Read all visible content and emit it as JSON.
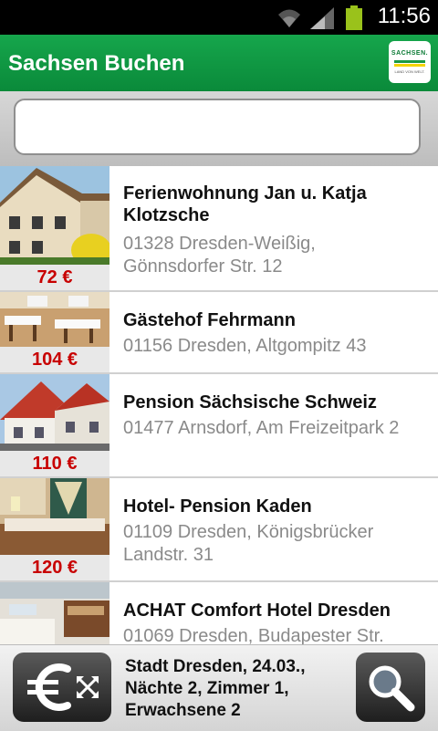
{
  "status_bar": {
    "time": "11:56",
    "icons": [
      "wifi-icon",
      "signal-icon",
      "battery-icon"
    ]
  },
  "header": {
    "title": "Sachsen Buchen",
    "logo_text": "SACHSEN.",
    "logo_subtext": "LAND VON WELT."
  },
  "search": {
    "value": "",
    "placeholder": ""
  },
  "hotels": [
    {
      "name": "Ferienwohnung Jan u. Katja Klotzsche",
      "address": "01328 Dresden-Weißig, Gönnsdorfer Str. 12",
      "price": "72 €"
    },
    {
      "name": "Gästehof Fehrmann",
      "address": "01156 Dresden, Altgompitz 43",
      "price": "104 €"
    },
    {
      "name": "Pension Sächsische Schweiz",
      "address": "01477 Arnsdorf, Am Freizeitpark 2",
      "price": "110 €"
    },
    {
      "name": "Hotel- Pension Kaden",
      "address": "01109 Dresden, Königsbrücker Landstr. 31",
      "price": "120 €"
    },
    {
      "name": "ACHAT Comfort Hotel Dresden",
      "address": "01069 Dresden, Budapester Str."
    }
  ],
  "footer": {
    "summary": "Stadt Dresden, 24.03., Nächte 2, Zimmer 1, Erwachsene 2",
    "price_filter_icon": "euro-icon",
    "search_icon": "magnifier-icon"
  },
  "colors": {
    "header": "#0f9a42",
    "price": "#c80000"
  }
}
